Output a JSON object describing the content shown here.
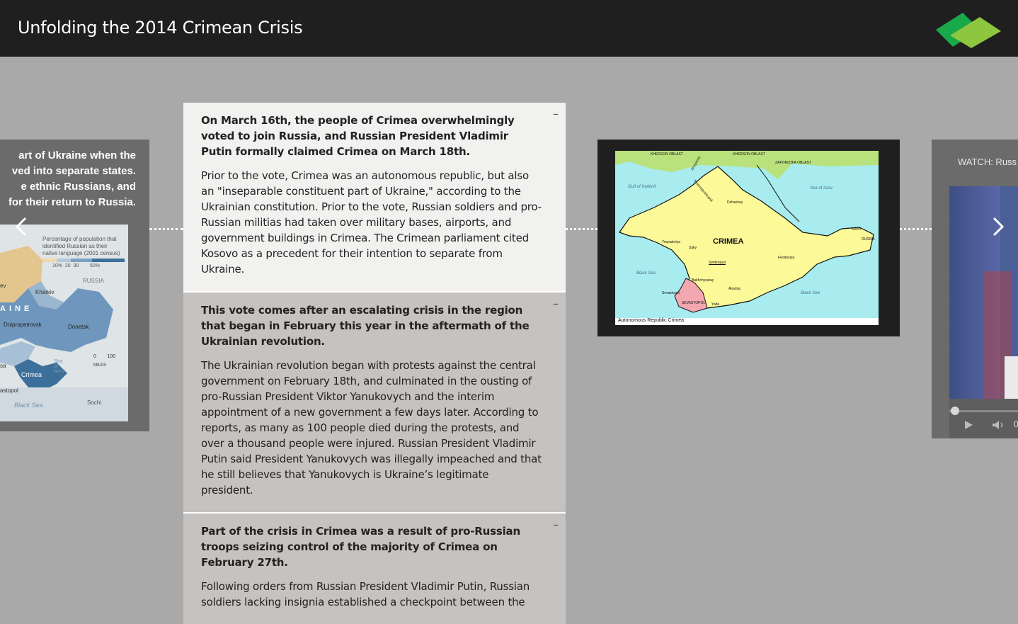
{
  "header": {
    "title": "Unfolding the 2014 Crimean Crisis"
  },
  "left_panel": {
    "text_lines": [
      "art of Ukraine when the",
      "ved into separate states.",
      "e ethnic Russians, and",
      "for their return to Russia."
    ],
    "map": {
      "legend_title_1": "Percentage of population that",
      "legend_title_2": "identified Russian as their",
      "legend_title_3": "native language (2001 census)",
      "legend_ticks": [
        "10%",
        "20",
        "30",
        "50%"
      ],
      "labels": [
        "RUSSIA",
        "Kharkiv",
        "AINE",
        "Dnipropetrovsk",
        "Donetsk",
        "Sea of Azov",
        "Crimea",
        "astopol",
        "Black Sea",
        "Sochi",
        "sa",
        "ev"
      ],
      "scale": [
        "0",
        "100",
        "MILES"
      ]
    }
  },
  "cards": [
    {
      "heading": "On March 16th, the people of Crimea overwhelmingly voted to join Russia, and Russian President Vladimir Putin formally claimed Crimea on March 18th.",
      "body": "Prior to the vote, Crimea was an autonomous republic, but also an \"inseparable constituent part of Ukraine,\" according to the Ukrainian constitution. Prior to the vote, Russian soldiers and pro-Russian militias had taken over military bases, airports, and government buildings in Crimea. The Crimean parliament cited Kosovo as a precedent for their intention to separate from Ukraine.",
      "collapse": "–"
    },
    {
      "heading": "This vote comes after an escalating crisis in the region that began in February this year in the aftermath of the Ukrainian revolution.",
      "body": "The Ukrainian revolution began with protests against the central government on February 18th, and culminated in the ousting of pro-Russian President Viktor Yanukovych and the interim appointment of a new government a few days later. According to reports, as many as 100 people died during the protests, and over a thousand people were injured. Russian President Vladimir Putin said President Yanukovych was illegally impeached and that he still believes that Yanukovych is Ukraine’s legitimate president.",
      "collapse": "–"
    },
    {
      "heading": "Part of the crisis in Crimea was a result of pro-Russian troops seizing control of the majority of Crimea on February 27th.",
      "body": "Following orders from Russian President Vladimir Putin, Russian soldiers lacking insignia established a checkpoint between the",
      "collapse": "–"
    }
  ],
  "crimea_map": {
    "title": "CRIMEA",
    "caption": "Autonomous Republic Crimea",
    "labels": [
      "KHERSON OBLAST",
      "KHERSON OBLAST",
      "ZAPORIZHIA OBLAST",
      "Gulf of Karkinit",
      "Sea of Azov",
      "Krasnoperekopsk",
      "Dzhankoy",
      "Yevpatoriya",
      "Saky",
      "Simferopol",
      "Feodosiya",
      "Kerch",
      "RUSSIA",
      "Black Sea",
      "Bakhchysaray",
      "Alushta",
      "Sevastopol",
      "SEVASTOPOL",
      "Yalta",
      "Black Sea",
      "Armyansk"
    ]
  },
  "video": {
    "title": "WATCH: Russ",
    "time": "0"
  },
  "colors": {
    "header_bg": "#1f1f1f",
    "page_bg": "#a9a9a9",
    "active_card": "#f1f1f0",
    "inactive_card": "#c5c2bf",
    "logo_dark": "#16a34a",
    "logo_light": "#8cc63f"
  }
}
